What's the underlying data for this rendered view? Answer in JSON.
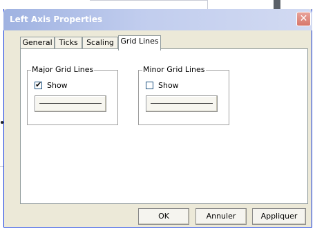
{
  "dialog": {
    "title": "Left Axis Properties",
    "close_symbol": "✕"
  },
  "tabs": [
    {
      "label": "General",
      "active": false
    },
    {
      "label": "Ticks",
      "active": false
    },
    {
      "label": "Scaling",
      "active": false
    },
    {
      "label": "Grid Lines",
      "active": true
    }
  ],
  "major": {
    "legend": "Major Grid Lines",
    "checkbox_label": "Show",
    "checked": true,
    "check_mark": "✔"
  },
  "minor": {
    "legend": "Minor Grid Lines",
    "checkbox_label": "Show",
    "checked": false
  },
  "buttons": {
    "ok": "OK",
    "cancel": "Annuler",
    "apply": "Appliquer"
  },
  "colors": {
    "dialog_face": "#ece9d8",
    "title_gradient_start": "#9fb2e1",
    "close_red": "#d7776a"
  },
  "icons": {
    "close": "close-icon",
    "check": "checkmark-icon",
    "line_style": "line-style-icon"
  }
}
